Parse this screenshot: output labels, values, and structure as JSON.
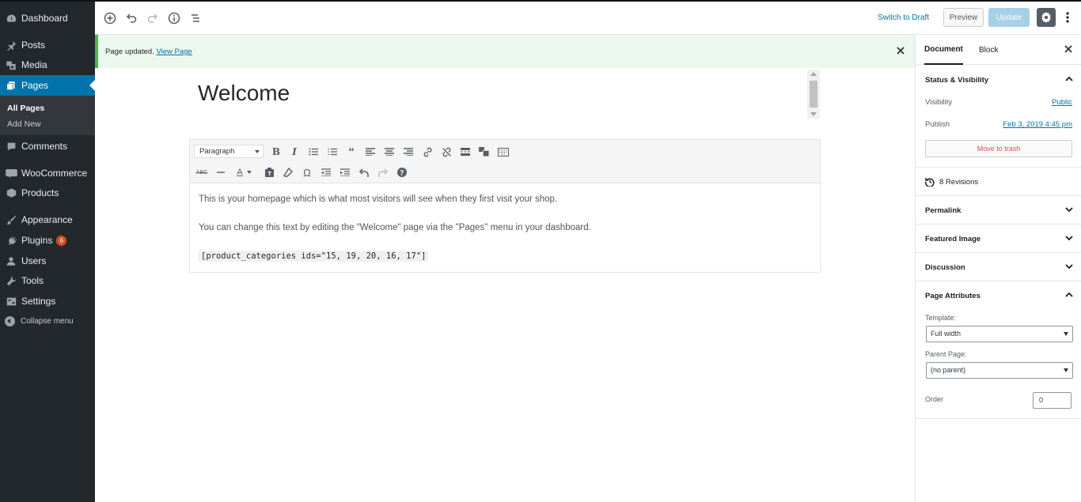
{
  "sidebar": {
    "items": [
      {
        "label": "Dashboard",
        "icon": "dashboard-icon"
      },
      {
        "label": "Posts",
        "icon": "pin-icon"
      },
      {
        "label": "Media",
        "icon": "media-icon"
      },
      {
        "label": "Pages",
        "icon": "pages-icon"
      },
      {
        "label": "Comments",
        "icon": "comment-icon"
      },
      {
        "label": "WooCommerce",
        "icon": "woocommerce-icon"
      },
      {
        "label": "Products",
        "icon": "products-icon"
      },
      {
        "label": "Appearance",
        "icon": "brush-icon"
      },
      {
        "label": "Plugins",
        "icon": "plugin-icon",
        "badge": "6"
      },
      {
        "label": "Users",
        "icon": "user-icon"
      },
      {
        "label": "Tools",
        "icon": "wrench-icon"
      },
      {
        "label": "Settings",
        "icon": "settings-icon"
      }
    ],
    "submenu": {
      "all_pages": "All Pages",
      "add_new": "Add New"
    },
    "collapse": "Collapse menu"
  },
  "topbar": {
    "switch_draft": "Switch to Draft",
    "preview": "Preview",
    "update": "Update"
  },
  "notice": {
    "text": "Page updated.",
    "link": "View Page"
  },
  "editor": {
    "title": "Welcome",
    "format": "Paragraph",
    "paragraphs": [
      "This is your homepage which is what most visitors will see when they first visit your shop.",
      "You can change this text by editing the \"Welcome\" page via the \"Pages\" menu in your dashboard."
    ],
    "shortcode": "[product_categories ids=\"15, 19, 20, 16, 17\"]"
  },
  "panel": {
    "tabs": [
      "Document",
      "Block"
    ],
    "status": {
      "title": "Status & Visibility",
      "visibility_label": "Visibility",
      "visibility_value": "Public",
      "publish_label": "Publish",
      "publish_value": "Feb 3, 2019 4:45 pm",
      "trash": "Move to trash"
    },
    "revisions": "8 Revisions",
    "sections": [
      "Permalink",
      "Featured Image",
      "Discussion"
    ],
    "attributes": {
      "title": "Page Attributes",
      "template_label": "Template:",
      "template_value": "Full width",
      "parent_label": "Parent Page:",
      "parent_value": "(no parent)",
      "order_label": "Order",
      "order_value": "0"
    }
  },
  "colors": {
    "sidebar": "#23282d",
    "accent": "#0073aa",
    "update": "#a5d0e6",
    "notice": "#46b450"
  }
}
